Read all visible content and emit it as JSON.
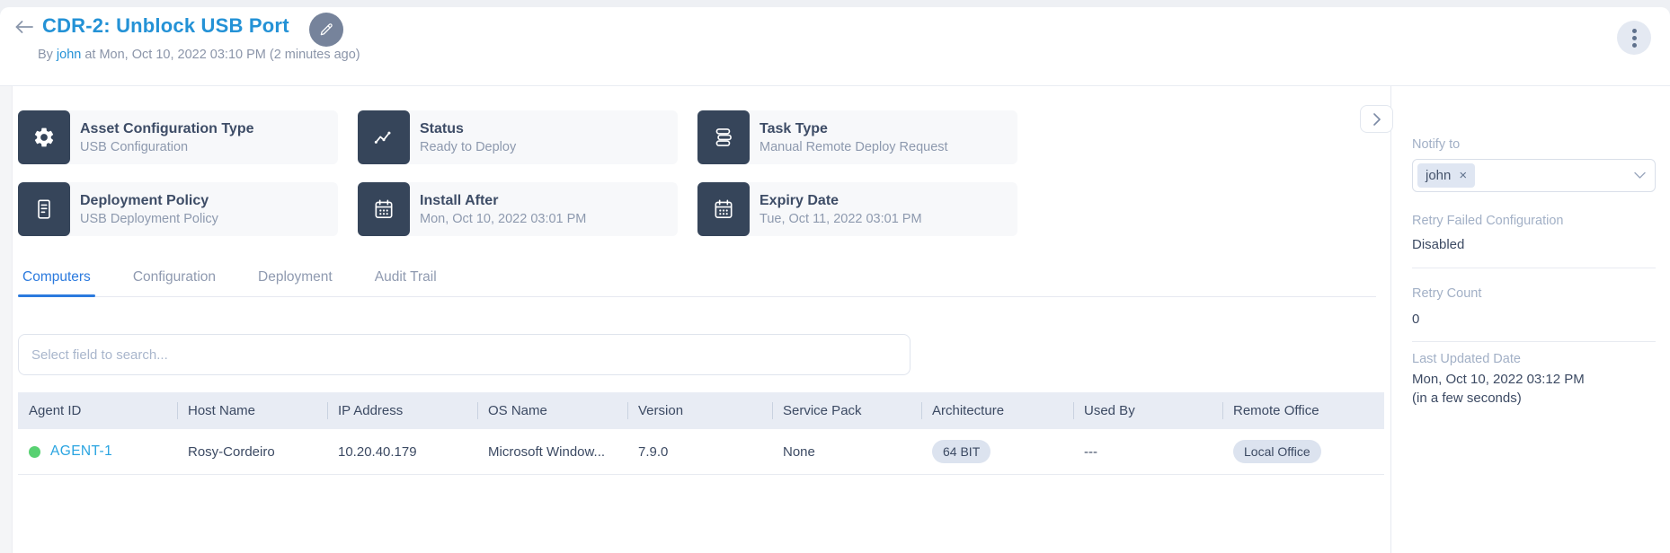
{
  "header": {
    "title": "CDR-2: Unblock USB Port",
    "byline_prefix": "By",
    "byline_user": "john",
    "byline_rest": "at Mon, Oct 10, 2022 03:10 PM (2 minutes ago)"
  },
  "cards": [
    {
      "icon": "gear-icon",
      "title": "Asset Configuration Type",
      "value": "USB Configuration"
    },
    {
      "icon": "activity-icon",
      "title": "Status",
      "value": "Ready to Deploy"
    },
    {
      "icon": "stack-icon",
      "title": "Task Type",
      "value": "Manual Remote Deploy Request"
    },
    {
      "icon": "document-icon",
      "title": "Deployment Policy",
      "value": "USB Deployment Policy"
    },
    {
      "icon": "calendar-icon",
      "title": "Install After",
      "value": "Mon, Oct 10, 2022 03:01 PM"
    },
    {
      "icon": "calendar-icon",
      "title": "Expiry Date",
      "value": "Tue, Oct 11, 2022 03:01 PM"
    }
  ],
  "tabs": [
    {
      "label": "Computers",
      "active": true
    },
    {
      "label": "Configuration",
      "active": false
    },
    {
      "label": "Deployment",
      "active": false
    },
    {
      "label": "Audit Trail",
      "active": false
    }
  ],
  "search": {
    "placeholder": "Select field to search..."
  },
  "table": {
    "columns": [
      "Agent ID",
      "Host Name",
      "IP Address",
      "OS Name",
      "Version",
      "Service Pack",
      "Architecture",
      "Used By",
      "Remote Office"
    ],
    "rows": [
      {
        "status": "online",
        "agent_id": "AGENT-1",
        "host_name": "Rosy-Cordeiro",
        "ip_address": "10.20.40.179",
        "os_name": "Microsoft Window...",
        "version": "7.9.0",
        "service_pack": "None",
        "architecture": "64 BIT",
        "used_by": "---",
        "remote_office": "Local Office"
      }
    ]
  },
  "sidebar": {
    "notify_to": {
      "label": "Notify to",
      "chip": "john",
      "chip_remove": "×"
    },
    "retry_failed_configuration": {
      "label": "Retry Failed Configuration",
      "value": "Disabled"
    },
    "retry_count": {
      "label": "Retry Count",
      "value": "0"
    },
    "last_updated": {
      "label": "Last Updated Date",
      "value": "Mon, Oct 10, 2022 03:12 PM",
      "relative": "(in a few seconds)"
    }
  },
  "colors": {
    "brand_blue": "#2492d6",
    "tab_active_blue": "#2b7ade",
    "link_blue": "#29a4e1",
    "status_green": "#58d172",
    "dark_navy": "#36455a",
    "table_header_bg": "#e8ecf4",
    "pill_bg": "#dce3ef",
    "muted_text": "#8d99ae",
    "sidebar_label": "#a2b0c6"
  }
}
